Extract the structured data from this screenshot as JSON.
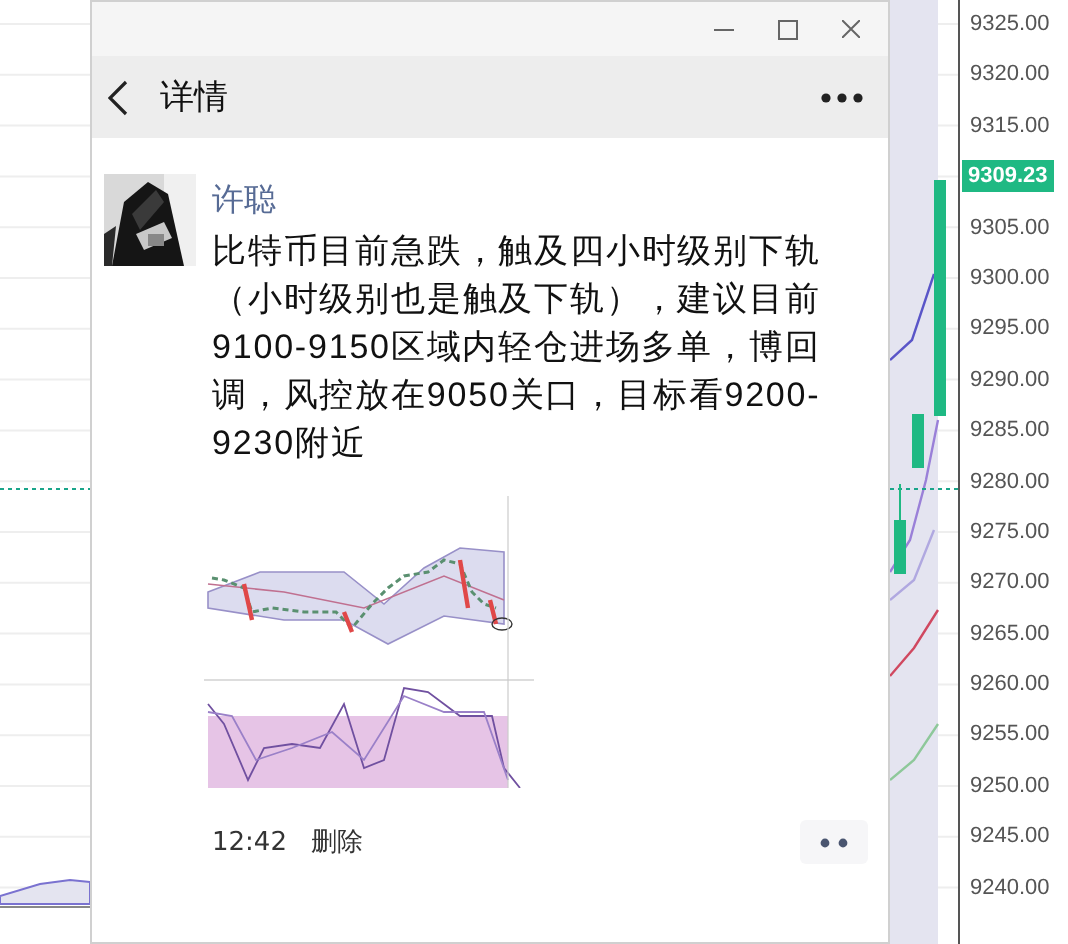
{
  "price_axis": {
    "labels": [
      "9325.00",
      "9320.00",
      "9315.00",
      "9305.00",
      "9300.00",
      "9295.00",
      "9290.00",
      "9285.00",
      "9280.00",
      "9275.00",
      "9270.00",
      "9265.00",
      "9260.00",
      "9255.00",
      "9250.00",
      "9245.00",
      "9240.00"
    ],
    "last_price": "9309.23"
  },
  "window": {
    "title": "详情"
  },
  "post": {
    "author": "许聪",
    "text": "比特币目前急跌，触及四小时级别下轨（小时级别也是触及下轨），建议目前9100-9150区域内轻仓进场多单，博回调，风控放在9050关口，目标看9200-9230附近",
    "time": "12:42",
    "delete_label": "删除"
  }
}
